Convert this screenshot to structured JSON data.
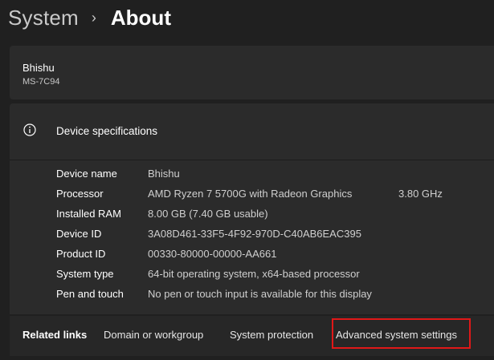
{
  "breadcrumb": {
    "parent": "System",
    "separator": "›",
    "current": "About"
  },
  "device": {
    "name": "Bhishu",
    "model": "MS-7C94"
  },
  "specs": {
    "title": "Device specifications",
    "icon": "info-icon",
    "rows": [
      {
        "label": "Device name",
        "value": "Bhishu",
        "extra": ""
      },
      {
        "label": "Processor",
        "value": "AMD Ryzen 7 5700G with Radeon Graphics",
        "extra": "3.80 GHz"
      },
      {
        "label": "Installed RAM",
        "value": "8.00 GB (7.40 GB usable)",
        "extra": ""
      },
      {
        "label": "Device ID",
        "value": "3A08D461-33F5-4F92-970D-C40AB6EAC395",
        "extra": ""
      },
      {
        "label": "Product ID",
        "value": "00330-80000-00000-AA661",
        "extra": ""
      },
      {
        "label": "System type",
        "value": "64-bit operating system, x64-based processor",
        "extra": ""
      },
      {
        "label": "Pen and touch",
        "value": "No pen or touch input is available for this display",
        "extra": ""
      }
    ]
  },
  "related": {
    "label": "Related links",
    "links": [
      "Domain or workgroup",
      "System protection",
      "Advanced system settings"
    ]
  },
  "colors": {
    "background": "#202020",
    "card": "#2b2b2b",
    "highlight": "#e01818"
  }
}
